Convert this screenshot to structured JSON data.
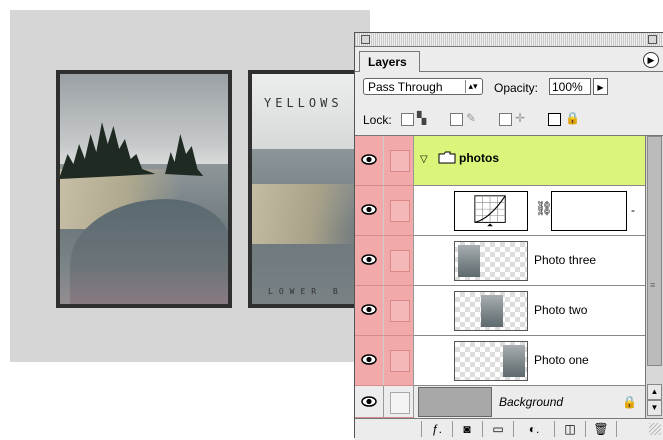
{
  "canvas": {
    "photo2_caption": "YELLOWS",
    "photo2_subcaption": "LOWER B"
  },
  "panel": {
    "tab_label": "Layers",
    "blend_mode": "Pass Through",
    "opacity_label": "Opacity:",
    "opacity_value": "100%",
    "lock_label": "Lock:"
  },
  "layers": {
    "group_name": "photos",
    "items": [
      {
        "name": "Photo three"
      },
      {
        "name": "Photo two"
      },
      {
        "name": "Photo one"
      }
    ],
    "background_name": "Background"
  },
  "colors": {
    "visibility_column": "#f2a9a9",
    "selected_group": "#dbf57a"
  },
  "icons": {
    "visibility": "eye-icon",
    "menu": "panel-menu-icon",
    "folder": "folder-icon",
    "adjustment": "curves-adjustment-icon",
    "chain": "chain-link-icon",
    "lock": "lock-icon"
  }
}
